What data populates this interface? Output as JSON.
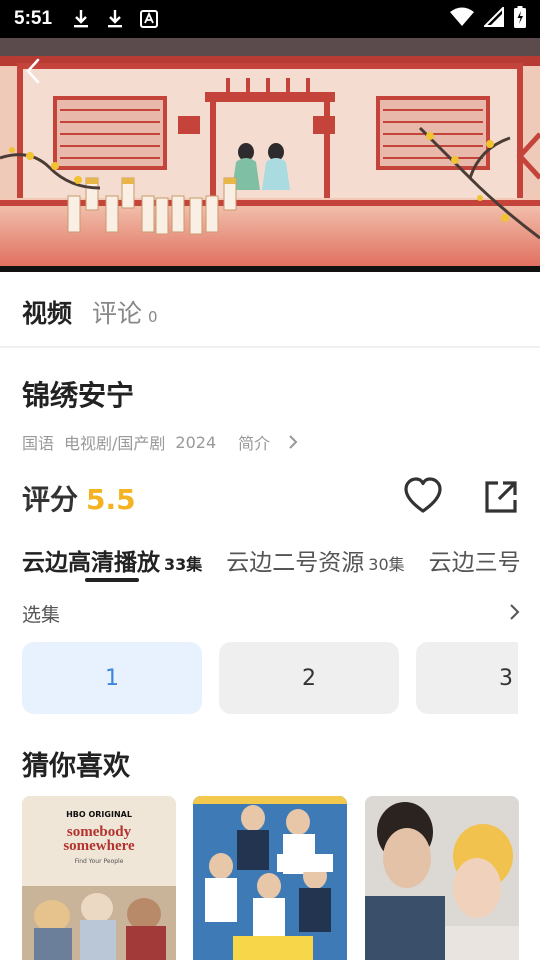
{
  "status_bar": {
    "time": "5:51"
  },
  "tabs": [
    {
      "label": "视频",
      "active": true
    },
    {
      "label": "评论",
      "count": "0",
      "active": false
    }
  ],
  "show": {
    "title": "锦绣安宁",
    "meta": [
      "国语",
      "电视剧/国产剧",
      "2024"
    ],
    "intro_label": "简介",
    "rating_label": "评分",
    "rating_value": "5.5"
  },
  "sources": [
    {
      "name": "云边高清播放",
      "episodes": "33集",
      "active": true
    },
    {
      "name": "云边二号资源",
      "episodes": "30集",
      "active": false
    },
    {
      "name": "云边三号",
      "episodes": "",
      "active": false
    }
  ],
  "episode_section": {
    "label": "选集",
    "episodes": [
      "1",
      "2",
      "3"
    ],
    "selected": "1"
  },
  "recommend": {
    "title": "猜你喜欢",
    "posters": [
      {
        "badge": "HBO ORIGINAL",
        "line1": "somebody",
        "line2": "somewhere",
        "tagline": "Find Your People"
      },
      {
        "badge": "",
        "line1": "",
        "line2": "",
        "tagline": ""
      },
      {
        "badge": "",
        "line1": "",
        "line2": "",
        "tagline": ""
      }
    ]
  },
  "colors": {
    "accent": "#f5b324",
    "episode_active_bg": "#e8f2fe",
    "episode_active_text": "#3b86d8"
  }
}
